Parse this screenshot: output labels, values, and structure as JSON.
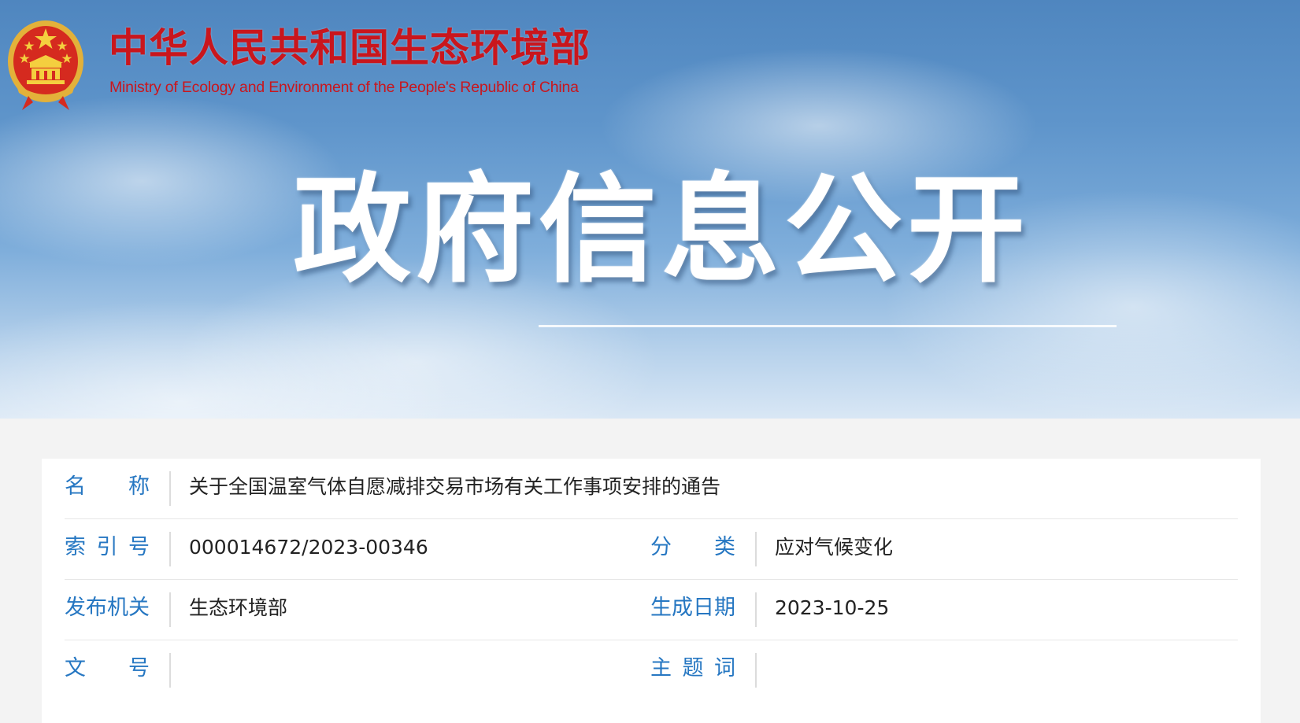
{
  "header": {
    "site_title_cn": "中华人民共和国生态环境部",
    "site_title_en": "Ministry of Ecology and Environment of the People's Republic of China",
    "hero_title": "政府信息公开"
  },
  "info": {
    "name": {
      "label": [
        "名",
        "称"
      ],
      "value": "关于全国温室气体自愿减排交易市场有关工作事项安排的通告"
    },
    "index_no": {
      "label": [
        "索",
        "引",
        "号"
      ],
      "value": "000014672/2023-00346"
    },
    "category": {
      "label": [
        "分",
        "类"
      ],
      "value": "应对气候变化"
    },
    "issuer": {
      "label": [
        "发",
        "布",
        "机",
        "关"
      ],
      "value": "生态环境部"
    },
    "date": {
      "label": [
        "生",
        "成",
        "日",
        "期"
      ],
      "value": "2023-10-25"
    },
    "doc_no": {
      "label": [
        "文",
        "号"
      ],
      "value": ""
    },
    "keywords": {
      "label": [
        "主",
        "题",
        "词"
      ],
      "value": ""
    }
  },
  "colors": {
    "brand_red": "#c9161d",
    "label_blue": "#2677c2",
    "emblem_gold": "#e3b13a"
  },
  "icons": {
    "emblem": "national-emblem-icon"
  }
}
